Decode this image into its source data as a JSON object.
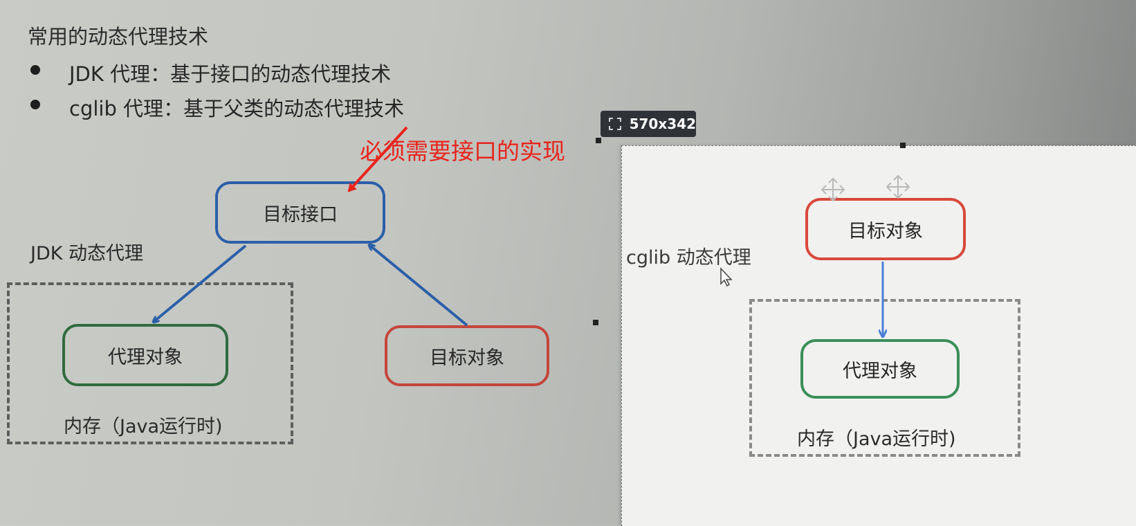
{
  "heading": "常用的动态代理技术",
  "bullets": [
    {
      "text": "JDK 代理：基于接口的动态代理技术"
    },
    {
      "text": "cglib 代理：基于父类的动态代理技术"
    }
  ],
  "annotation": "必须需要接口的实现",
  "jdk_diagram": {
    "label": "JDK 动态代理",
    "interface_box": "目标接口",
    "proxy_box": "代理对象",
    "target_box": "目标对象",
    "memory_label": "内存（Java运行时)"
  },
  "cglib_panel": {
    "size_badge": "570x342",
    "label": "cglib 动态代理",
    "target_box": "目标对象",
    "proxy_box": "代理对象",
    "memory_label": "内存（Java运行时)"
  },
  "colors": {
    "blue": "#2b5fa8",
    "green": "#2f6b3e",
    "red": "#c4463c",
    "annotation_red": "#e8241c"
  }
}
